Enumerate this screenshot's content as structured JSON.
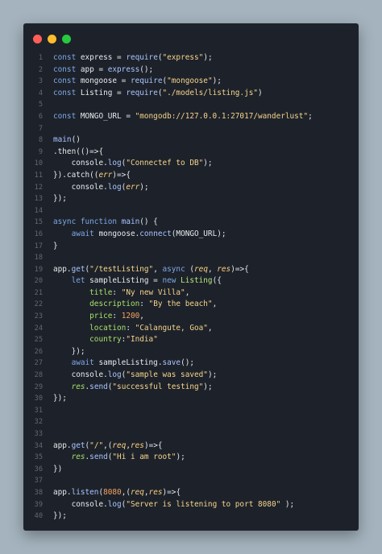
{
  "window": {
    "controls": [
      "close",
      "minimize",
      "maximize"
    ]
  },
  "lines": [
    {
      "n": "1",
      "t": [
        [
          "kw",
          "const "
        ],
        [
          "",
          "express = "
        ],
        [
          "fn",
          "require"
        ],
        [
          "",
          "("
        ],
        [
          "str",
          "\"express\""
        ],
        [
          "",
          ");"
        ]
      ]
    },
    {
      "n": "2",
      "t": [
        [
          "kw",
          "const "
        ],
        [
          "",
          "app = "
        ],
        [
          "fn",
          "express"
        ],
        [
          "",
          "();"
        ]
      ]
    },
    {
      "n": "3",
      "t": [
        [
          "kw",
          "const "
        ],
        [
          "",
          "mongoose = "
        ],
        [
          "fn",
          "require"
        ],
        [
          "",
          "("
        ],
        [
          "str",
          "\"mongoose\""
        ],
        [
          "",
          ");"
        ]
      ]
    },
    {
      "n": "4",
      "t": [
        [
          "kw",
          "const "
        ],
        [
          "",
          "Listing = "
        ],
        [
          "fn",
          "require"
        ],
        [
          "",
          "("
        ],
        [
          "str",
          "\"./models/listing.js\""
        ],
        [
          "",
          ")"
        ]
      ]
    },
    {
      "n": "5",
      "t": []
    },
    {
      "n": "6",
      "t": [
        [
          "kw",
          "const "
        ],
        [
          "",
          "MONGO_URL = "
        ],
        [
          "str",
          "\"mongodb://127.0.0.1:27017/wanderlust\""
        ],
        [
          "",
          ";"
        ]
      ]
    },
    {
      "n": "7",
      "t": []
    },
    {
      "n": "8",
      "t": [
        [
          "fn",
          "main"
        ],
        [
          "",
          "()"
        ]
      ]
    },
    {
      "n": "9",
      "t": [
        [
          "",
          ".then(()=>{"
        ]
      ]
    },
    {
      "n": "10",
      "t": [
        [
          "",
          "    console."
        ],
        [
          "fn",
          "log"
        ],
        [
          "",
          "("
        ],
        [
          "str",
          "\"Connectef to DB\""
        ],
        [
          "",
          ");"
        ]
      ]
    },
    {
      "n": "11",
      "t": [
        [
          "",
          "}).catch(("
        ],
        [
          "par",
          "err"
        ],
        [
          "",
          ")=>{"
        ]
      ]
    },
    {
      "n": "12",
      "t": [
        [
          "",
          "    console."
        ],
        [
          "fn",
          "log"
        ],
        [
          "",
          "("
        ],
        [
          "par",
          "err"
        ],
        [
          "",
          ");"
        ]
      ]
    },
    {
      "n": "13",
      "t": [
        [
          "",
          "});"
        ]
      ]
    },
    {
      "n": "14",
      "t": []
    },
    {
      "n": "15",
      "t": [
        [
          "kw",
          "async function "
        ],
        [
          "fn",
          "main"
        ],
        [
          "",
          "() {"
        ]
      ]
    },
    {
      "n": "16",
      "t": [
        [
          "",
          "    "
        ],
        [
          "kw",
          "await "
        ],
        [
          "",
          "mongoose."
        ],
        [
          "fn",
          "connect"
        ],
        [
          "",
          "(MONGO_URL);"
        ]
      ]
    },
    {
      "n": "17",
      "t": [
        [
          "",
          "}"
        ]
      ]
    },
    {
      "n": "18",
      "t": []
    },
    {
      "n": "19",
      "t": [
        [
          "",
          "app."
        ],
        [
          "fn",
          "get"
        ],
        [
          "",
          "("
        ],
        [
          "str",
          "\"/testListing\""
        ],
        [
          "",
          ", "
        ],
        [
          "kw",
          "async "
        ],
        [
          "",
          "("
        ],
        [
          "par",
          "req"
        ],
        [
          "",
          ", "
        ],
        [
          "par",
          "res"
        ],
        [
          "",
          ")=>{"
        ]
      ]
    },
    {
      "n": "20",
      "t": [
        [
          "",
          "    "
        ],
        [
          "kw",
          "let "
        ],
        [
          "",
          "sampleListing = "
        ],
        [
          "kw",
          "new "
        ],
        [
          "typ",
          "Listing"
        ],
        [
          "",
          "({"
        ]
      ]
    },
    {
      "n": "21",
      "t": [
        [
          "",
          "        "
        ],
        [
          "key",
          "title"
        ],
        [
          "",
          ": "
        ],
        [
          "str",
          "\"Ny new Villa\""
        ],
        [
          "",
          ","
        ]
      ]
    },
    {
      "n": "22",
      "t": [
        [
          "",
          "        "
        ],
        [
          "key",
          "description"
        ],
        [
          "",
          ": "
        ],
        [
          "str",
          "\"By the beach\""
        ],
        [
          "",
          ","
        ]
      ]
    },
    {
      "n": "23",
      "t": [
        [
          "",
          "        "
        ],
        [
          "key",
          "price"
        ],
        [
          "",
          ": "
        ],
        [
          "num",
          "1200"
        ],
        [
          "",
          ","
        ]
      ]
    },
    {
      "n": "24",
      "t": [
        [
          "",
          "        "
        ],
        [
          "key",
          "location"
        ],
        [
          "",
          ": "
        ],
        [
          "str",
          "\"Calangute, Goa\""
        ],
        [
          "",
          ","
        ]
      ]
    },
    {
      "n": "25",
      "t": [
        [
          "",
          "        "
        ],
        [
          "key",
          "country"
        ],
        [
          "",
          ":"
        ],
        [
          "str",
          "\"India\""
        ]
      ]
    },
    {
      "n": "26",
      "t": [
        [
          "",
          "    });"
        ]
      ]
    },
    {
      "n": "27",
      "t": [
        [
          "",
          "    "
        ],
        [
          "kw",
          "await "
        ],
        [
          "",
          "sampleListing."
        ],
        [
          "fn",
          "save"
        ],
        [
          "",
          "();"
        ]
      ]
    },
    {
      "n": "28",
      "t": [
        [
          "",
          "    console."
        ],
        [
          "fn",
          "log"
        ],
        [
          "",
          "("
        ],
        [
          "str",
          "\"sample was saved\""
        ],
        [
          "",
          ");"
        ]
      ]
    },
    {
      "n": "29",
      "t": [
        [
          "",
          "    "
        ],
        [
          "obj",
          "res"
        ],
        [
          "",
          "."
        ],
        [
          "fn",
          "send"
        ],
        [
          "",
          "("
        ],
        [
          "str",
          "\"successful testing\""
        ],
        [
          "",
          ");"
        ]
      ]
    },
    {
      "n": "30",
      "t": [
        [
          "",
          "});"
        ]
      ]
    },
    {
      "n": "31",
      "t": []
    },
    {
      "n": "32",
      "t": []
    },
    {
      "n": "33",
      "t": []
    },
    {
      "n": "34",
      "t": [
        [
          "",
          "app."
        ],
        [
          "fn",
          "get"
        ],
        [
          "",
          "("
        ],
        [
          "str",
          "\"/\""
        ],
        [
          "",
          ",("
        ],
        [
          "par",
          "req"
        ],
        [
          "",
          ","
        ],
        [
          "par",
          "res"
        ],
        [
          "",
          ")=>{"
        ]
      ]
    },
    {
      "n": "35",
      "t": [
        [
          "",
          "    "
        ],
        [
          "obj",
          "res"
        ],
        [
          "",
          "."
        ],
        [
          "fn",
          "send"
        ],
        [
          "",
          "("
        ],
        [
          "str",
          "\"Hi i am root\""
        ],
        [
          "",
          ");"
        ]
      ]
    },
    {
      "n": "36",
      "t": [
        [
          "",
          "})"
        ]
      ]
    },
    {
      "n": "37",
      "t": []
    },
    {
      "n": "38",
      "t": [
        [
          "",
          "app."
        ],
        [
          "fn",
          "listen"
        ],
        [
          "",
          "("
        ],
        [
          "num",
          "8080"
        ],
        [
          "",
          ",("
        ],
        [
          "par",
          "req"
        ],
        [
          "",
          ","
        ],
        [
          "par",
          "res"
        ],
        [
          "",
          ")=>{"
        ]
      ]
    },
    {
      "n": "39",
      "t": [
        [
          "",
          "    console."
        ],
        [
          "fn",
          "log"
        ],
        [
          "",
          "("
        ],
        [
          "str",
          "\"Server is listening to port 8080\""
        ],
        [
          "",
          " );"
        ]
      ]
    },
    {
      "n": "40",
      "t": [
        [
          "",
          "});"
        ]
      ]
    }
  ]
}
